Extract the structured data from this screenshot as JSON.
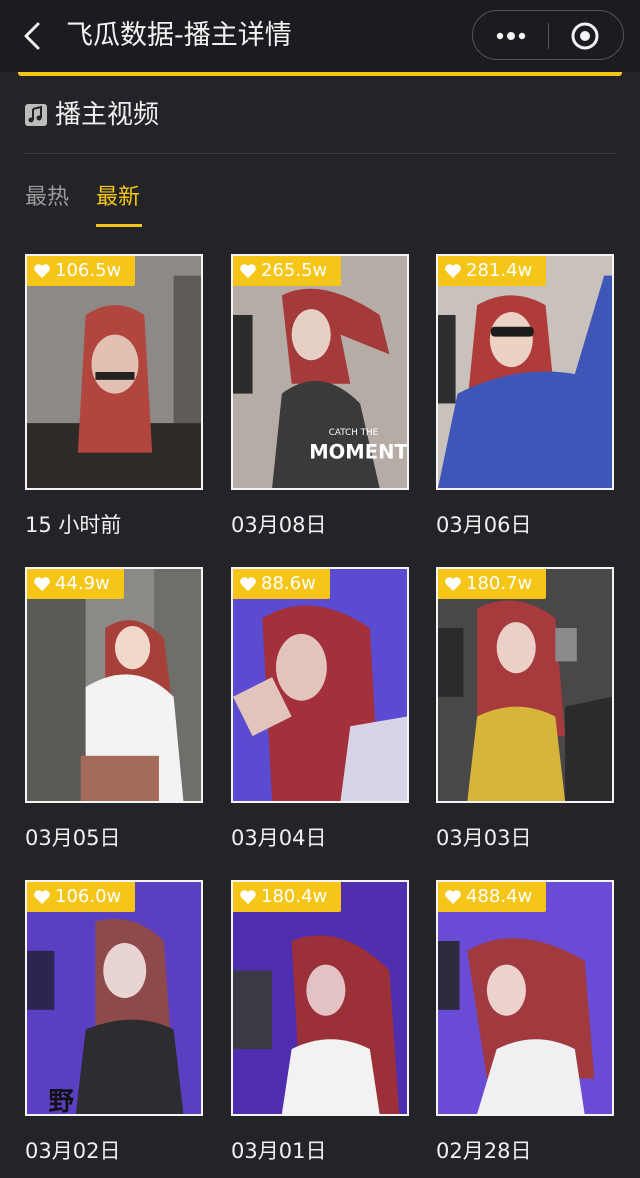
{
  "nav": {
    "title": "飞瓜数据-播主详情",
    "back_icon": "chevron-left-icon",
    "more_icon": "more-dots-icon",
    "close_icon": "record-target-icon"
  },
  "section": {
    "title": "播主视频",
    "icon": "music-note-icon"
  },
  "tabs": [
    {
      "label": "最热",
      "active": false
    },
    {
      "label": "最新",
      "active": true
    }
  ],
  "colors": {
    "accent": "#f5c518",
    "background": "#232428",
    "navbar": "#1b1c1f"
  },
  "videos": [
    {
      "likes": "106.5w",
      "date": "15 小时前"
    },
    {
      "likes": "265.5w",
      "date": "03月08日"
    },
    {
      "likes": "281.4w",
      "date": "03月06日"
    },
    {
      "likes": "44.9w",
      "date": "03月05日"
    },
    {
      "likes": "88.6w",
      "date": "03月04日"
    },
    {
      "likes": "180.7w",
      "date": "03月03日"
    },
    {
      "likes": "106.0w",
      "date": "03月02日"
    },
    {
      "likes": "180.4w",
      "date": "03月01日"
    },
    {
      "likes": "488.4w",
      "date": "02月28日"
    }
  ]
}
